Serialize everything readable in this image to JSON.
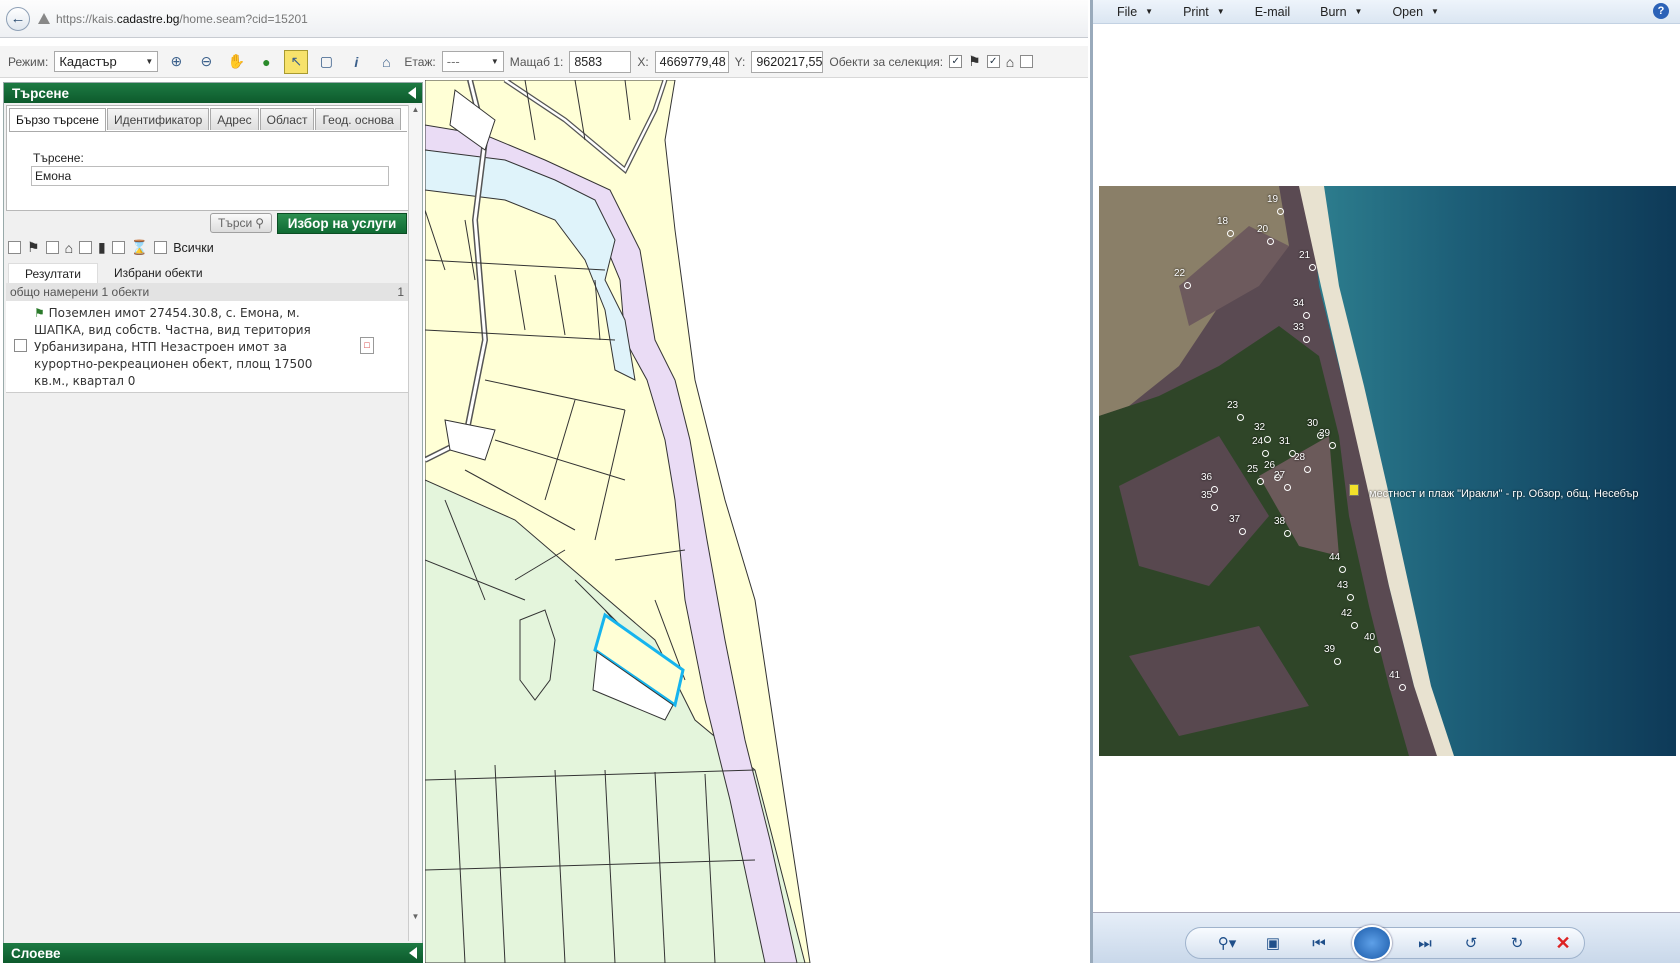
{
  "browser": {
    "url_prefix": "https://kais.",
    "url_domain": "cadastre.bg",
    "url_suffix": "/home.seam?cid=15201"
  },
  "toolbar": {
    "mode_label": "Режим:",
    "mode_value": "Кадастър",
    "floor_label": "Етаж:",
    "floor_value": "---",
    "scale_label": "Мащаб 1:",
    "scale_value": "8583",
    "x_label": "X:",
    "x_value": "4669779,48",
    "y_label": "Y:",
    "y_value": "9620217,55",
    "selection_label": "Обекти за селекция:"
  },
  "search_panel": {
    "title": "Търсене",
    "tabs": [
      "Бързо търсене",
      "Идентификатор",
      "Адрес",
      "Област",
      "Геод. основа"
    ],
    "search_label": "Търсене:",
    "search_value": "Емона",
    "search_button": "Търси",
    "services_button": "Избор на услуги",
    "all_label": "Всички",
    "result_tabs": [
      "Резултати",
      "Избрани обекти"
    ],
    "found_text": "общо намерени 1 обекти",
    "found_count": "1",
    "result_text": "Поземлен имот 27454.30.8, с. Емона, м. ШАПКА, вид собств. Частна, вид територия Урбанизирана, НТП Незастроен имот за курортно-рекреационен обект, площ 17500 кв.м., квартал 0"
  },
  "layers_panel": {
    "title": "Слоеве"
  },
  "viewer": {
    "menu": [
      "File",
      "Print",
      "E-mail",
      "Burn",
      "Open"
    ],
    "help": "?",
    "placemark_label": "местност и плаж \"Иракли\" - гр. Обзор, общ. Несебър",
    "point_labels": [
      "19",
      "18",
      "20",
      "21",
      "22",
      "34",
      "33",
      "23",
      "32",
      "30",
      "29",
      "24",
      "31",
      "28",
      "26",
      "25",
      "27",
      "36",
      "35",
      "37",
      "38",
      "44",
      "43",
      "42",
      "40",
      "39",
      "41"
    ]
  },
  "colors": {
    "green_header": "#0d5a2c",
    "parcel_fill": "#ffffd6",
    "forest_fill": "#e4f5dc",
    "river": "#dff3fa",
    "beach": "#eadcf5",
    "highlight": "#16b4ee"
  }
}
